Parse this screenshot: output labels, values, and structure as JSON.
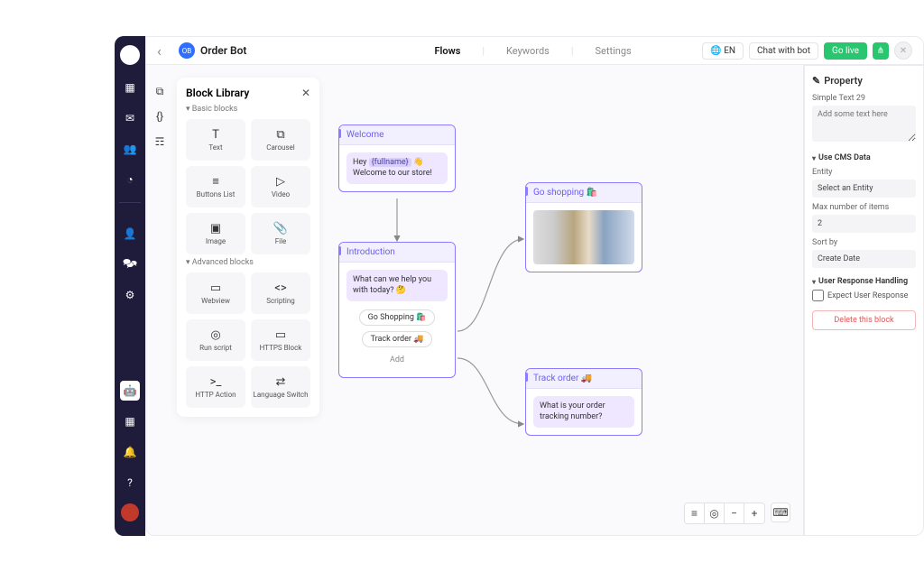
{
  "header": {
    "app_badge": "OB",
    "title": "Order Bot",
    "tabs": [
      "Flows",
      "Keywords",
      "Settings"
    ],
    "active_tab": "Flows",
    "lang_label": "EN",
    "chat_label": "Chat with bot",
    "go_live_label": "Go live"
  },
  "library": {
    "title": "Block Library",
    "sections": [
      {
        "label": "Basic blocks",
        "items": [
          {
            "icon": "T",
            "label": "Text"
          },
          {
            "icon": "⧉",
            "label": "Carousel"
          },
          {
            "icon": "≡",
            "label": "Buttons List"
          },
          {
            "icon": "▷",
            "label": "Video"
          },
          {
            "icon": "▣",
            "label": "Image"
          },
          {
            "icon": "📎",
            "label": "File"
          }
        ]
      },
      {
        "label": "Advanced blocks",
        "items": [
          {
            "icon": "▭",
            "label": "Webview"
          },
          {
            "icon": "<>",
            "label": "Scripting"
          },
          {
            "icon": "◎",
            "label": "Run script"
          },
          {
            "icon": "▭",
            "label": "HTTPS Block"
          },
          {
            "icon": ">_",
            "label": "HTTP Action"
          },
          {
            "icon": "⇄",
            "label": "Language Switch"
          }
        ]
      }
    ]
  },
  "nodes": {
    "welcome": {
      "title": "Welcome",
      "msg_pre": "Hey ",
      "msg_tag": "{fullname}",
      "msg_post": " 👋 Welcome to our store!"
    },
    "intro": {
      "title": "Introduction",
      "prompt": "What can we help you with today? 🤔",
      "btn1": "Go Shopping 🛍️",
      "btn2": "Track order 🚚",
      "add": "Add"
    },
    "shop": {
      "title": "Go shopping 🛍️"
    },
    "track": {
      "title": "Track order 🚚",
      "prompt": "What is your order tracking number?"
    }
  },
  "props": {
    "title": "Property",
    "block_name": "Simple Text 29",
    "placeholder_text": "Add some text here",
    "cms_section": "Use CMS Data",
    "entity_label": "Entity",
    "entity_value": "Select an Entity",
    "max_label": "Max number of items",
    "max_value": "2",
    "sort_label": "Sort by",
    "sort_value": "Create Date",
    "resp_section": "User Response Handling",
    "expect_label": "Expect User Response",
    "delete_label": "Delete this block"
  }
}
